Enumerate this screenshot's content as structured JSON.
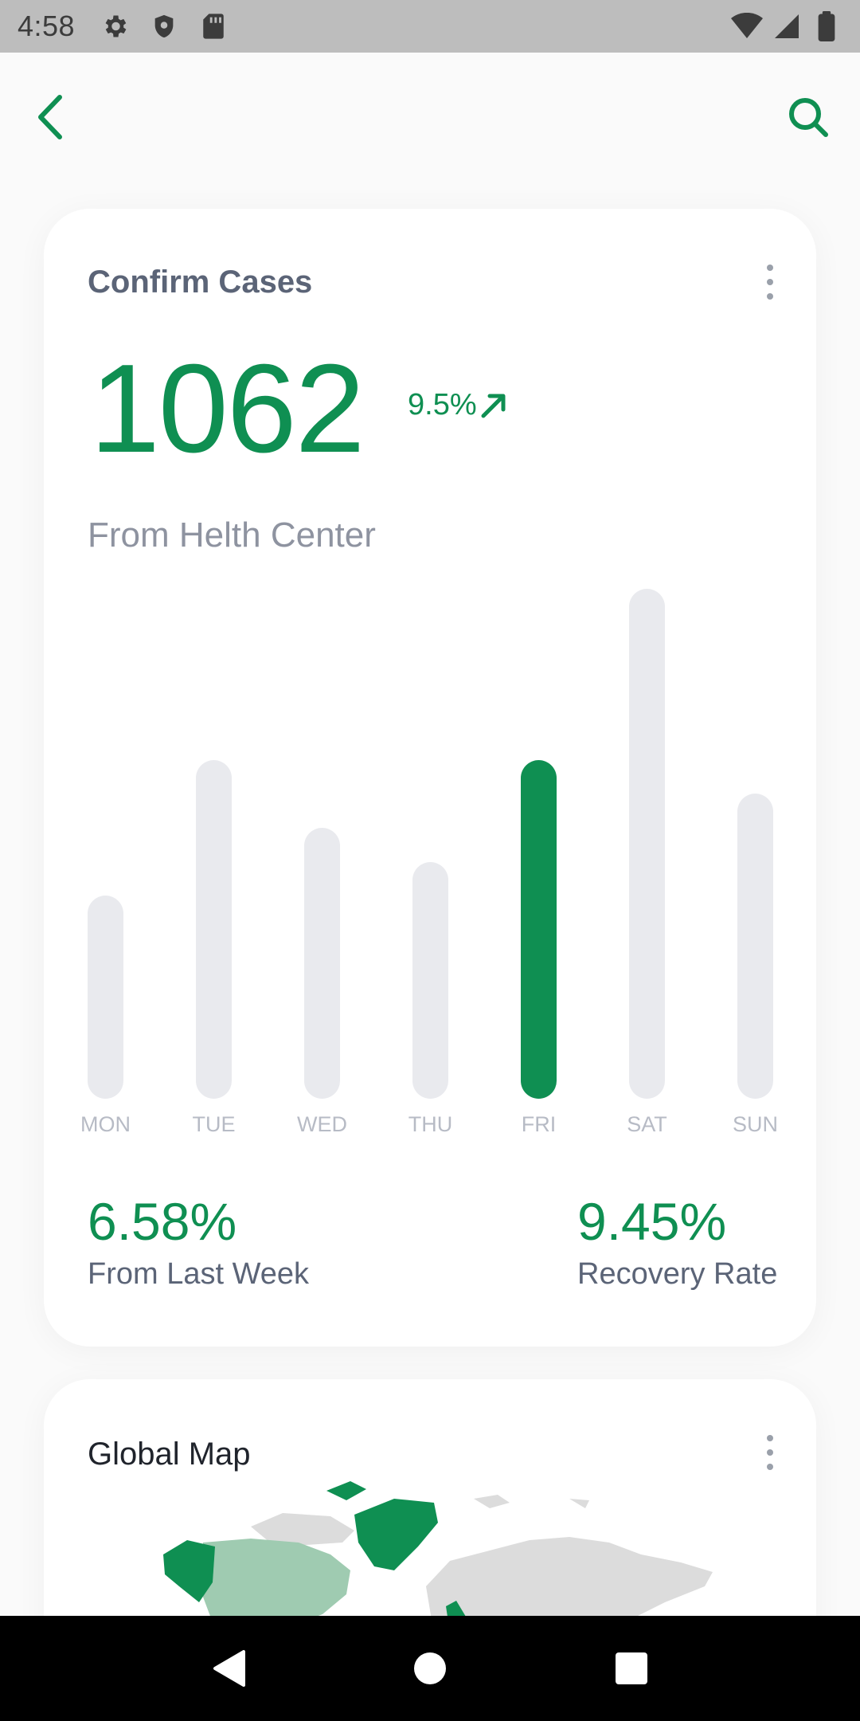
{
  "status_bar": {
    "time": "4:58",
    "left_icons": [
      "settings-icon",
      "shield-icon",
      "sd-card-icon"
    ],
    "right_icons": [
      "wifi-icon",
      "cell-signal-icon",
      "battery-icon"
    ]
  },
  "app_bar": {
    "back_icon": "chevron-left-icon",
    "search_icon": "search-icon",
    "accent": "#0f8f52"
  },
  "cases_card": {
    "title": "Confirm Cases",
    "total": "1062",
    "change": "9.5%",
    "change_direction": "up",
    "subtitle": "From Helth Center",
    "stats": [
      {
        "value": "6.58%",
        "label": "From Last Week"
      },
      {
        "value": "9.45%",
        "label": "Recovery Rate"
      }
    ]
  },
  "chart_data": {
    "type": "bar",
    "categories": [
      "MON",
      "TUE",
      "WED",
      "THU",
      "FRI",
      "SAT",
      "SUN"
    ],
    "values": [
      255,
      425,
      340,
      297,
      425,
      640,
      383
    ],
    "highlighted": "FRI",
    "colors": {
      "bar": "#e9eaee",
      "highlight": "#0f8f52"
    }
  },
  "map_card": {
    "title": "Global Map",
    "colors": {
      "highlight": "#0f8f52",
      "light_highlight": "#9fcbb1",
      "neutral": "#dcdcdc"
    }
  },
  "nav_bar": {
    "buttons": [
      "back-triangle-icon",
      "home-circle-icon",
      "recents-square-icon"
    ]
  }
}
